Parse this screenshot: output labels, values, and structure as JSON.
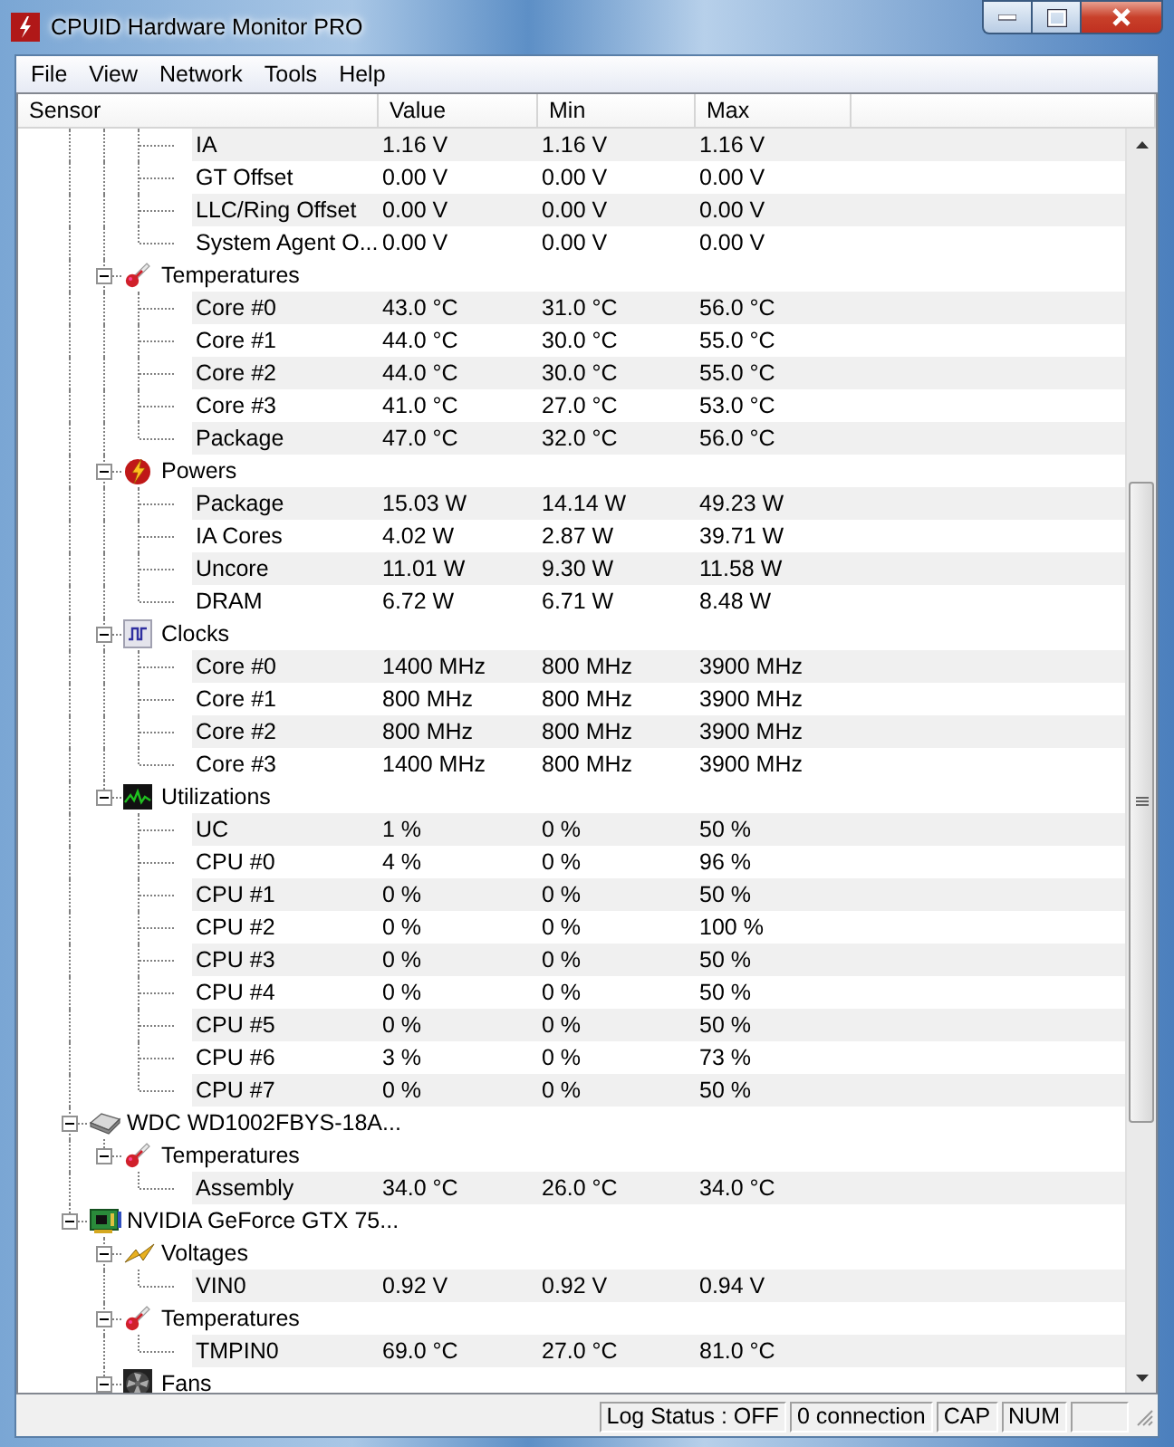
{
  "window": {
    "title": "CPUID Hardware Monitor PRO"
  },
  "menu": [
    "File",
    "View",
    "Network",
    "Tools",
    "Help"
  ],
  "columns": [
    "Sensor",
    "Value",
    "Min",
    "Max"
  ],
  "tree": [
    {
      "children": [
        {
          "children": [
            {
              "label": "IA",
              "value": "1.16 V",
              "min": "1.16 V",
              "max": "1.16 V"
            },
            {
              "label": "GT Offset",
              "value": "0.00 V",
              "min": "0.00 V",
              "max": "0.00 V"
            },
            {
              "label": "LLC/Ring Offset",
              "value": "0.00 V",
              "min": "0.00 V",
              "max": "0.00 V"
            },
            {
              "label": "System Agent O...",
              "value": "0.00 V",
              "min": "0.00 V",
              "max": "0.00 V"
            }
          ]
        },
        {
          "label": "Temperatures",
          "kind": "thermometer",
          "expanded": true,
          "children": [
            {
              "label": "Core #0",
              "value": "43.0 °C",
              "min": "31.0 °C",
              "max": "56.0 °C"
            },
            {
              "label": "Core #1",
              "value": "44.0 °C",
              "min": "30.0 °C",
              "max": "55.0 °C"
            },
            {
              "label": "Core #2",
              "value": "44.0 °C",
              "min": "30.0 °C",
              "max": "55.0 °C"
            },
            {
              "label": "Core #3",
              "value": "41.0 °C",
              "min": "27.0 °C",
              "max": "53.0 °C"
            },
            {
              "label": "Package",
              "value": "47.0 °C",
              "min": "32.0 °C",
              "max": "56.0 °C"
            }
          ]
        },
        {
          "label": "Powers",
          "kind": "power",
          "expanded": true,
          "children": [
            {
              "label": "Package",
              "value": "15.03 W",
              "min": "14.14 W",
              "max": "49.23 W"
            },
            {
              "label": "IA Cores",
              "value": "4.02 W",
              "min": "2.87 W",
              "max": "39.71 W"
            },
            {
              "label": "Uncore",
              "value": "11.01 W",
              "min": "9.30 W",
              "max": "11.58 W"
            },
            {
              "label": "DRAM",
              "value": "6.72 W",
              "min": "6.71 W",
              "max": "8.48 W"
            }
          ]
        },
        {
          "label": "Clocks",
          "kind": "clock",
          "expanded": true,
          "children": [
            {
              "label": "Core #0",
              "value": "1400 MHz",
              "min": "800 MHz",
              "max": "3900 MHz"
            },
            {
              "label": "Core #1",
              "value": "800 MHz",
              "min": "800 MHz",
              "max": "3900 MHz"
            },
            {
              "label": "Core #2",
              "value": "800 MHz",
              "min": "800 MHz",
              "max": "3900 MHz"
            },
            {
              "label": "Core #3",
              "value": "1400 MHz",
              "min": "800 MHz",
              "max": "3900 MHz"
            }
          ]
        },
        {
          "label": "Utilizations",
          "kind": "utilization",
          "expanded": true,
          "children": [
            {
              "label": "UC",
              "value": "1 %",
              "min": "0 %",
              "max": "50 %"
            },
            {
              "label": "CPU #0",
              "value": "4 %",
              "min": "0 %",
              "max": "96 %"
            },
            {
              "label": "CPU #1",
              "value": "0 %",
              "min": "0 %",
              "max": "50 %"
            },
            {
              "label": "CPU #2",
              "value": "0 %",
              "min": "0 %",
              "max": "100 %"
            },
            {
              "label": "CPU #3",
              "value": "0 %",
              "min": "0 %",
              "max": "50 %"
            },
            {
              "label": "CPU #4",
              "value": "0 %",
              "min": "0 %",
              "max": "50 %"
            },
            {
              "label": "CPU #5",
              "value": "0 %",
              "min": "0 %",
              "max": "50 %"
            },
            {
              "label": "CPU #6",
              "value": "3 %",
              "min": "0 %",
              "max": "73 %"
            },
            {
              "label": "CPU #7",
              "value": "0 %",
              "min": "0 %",
              "max": "50 %"
            }
          ]
        }
      ]
    },
    {
      "label": "WDC WD1002FBYS-18A...",
      "kind": "disk",
      "expanded": true,
      "children": [
        {
          "label": "Temperatures",
          "kind": "thermometer",
          "expanded": true,
          "children": [
            {
              "label": "Assembly",
              "value": "34.0 °C",
              "min": "26.0 °C",
              "max": "34.0 °C"
            }
          ]
        }
      ]
    },
    {
      "label": "NVIDIA GeForce GTX 75...",
      "kind": "gpu",
      "expanded": true,
      "children": [
        {
          "label": "Voltages",
          "kind": "voltage",
          "expanded": true,
          "children": [
            {
              "label": "VIN0",
              "value": "0.92 V",
              "min": "0.92 V",
              "max": "0.94 V"
            }
          ]
        },
        {
          "label": "Temperatures",
          "kind": "thermometer",
          "expanded": true,
          "children": [
            {
              "label": "TMPIN0",
              "value": "69.0 °C",
              "min": "27.0 °C",
              "max": "81.0 °C"
            }
          ]
        },
        {
          "label": "Fans",
          "kind": "fan",
          "expanded": true
        }
      ]
    }
  ],
  "status_bar": [
    "Log Status : OFF",
    "0 connection",
    "CAP",
    "NUM"
  ]
}
